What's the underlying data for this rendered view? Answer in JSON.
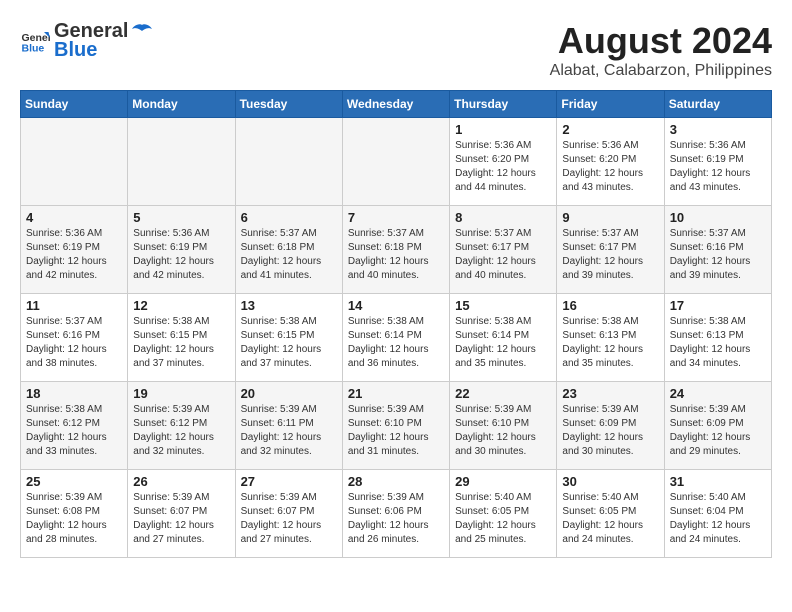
{
  "header": {
    "logo_general": "General",
    "logo_blue": "Blue",
    "month_year": "August 2024",
    "location": "Alabat, Calabarzon, Philippines"
  },
  "weekdays": [
    "Sunday",
    "Monday",
    "Tuesday",
    "Wednesday",
    "Thursday",
    "Friday",
    "Saturday"
  ],
  "weeks": [
    [
      {
        "day": "",
        "info": ""
      },
      {
        "day": "",
        "info": ""
      },
      {
        "day": "",
        "info": ""
      },
      {
        "day": "",
        "info": ""
      },
      {
        "day": "1",
        "info": "Sunrise: 5:36 AM\nSunset: 6:20 PM\nDaylight: 12 hours\nand 44 minutes."
      },
      {
        "day": "2",
        "info": "Sunrise: 5:36 AM\nSunset: 6:20 PM\nDaylight: 12 hours\nand 43 minutes."
      },
      {
        "day": "3",
        "info": "Sunrise: 5:36 AM\nSunset: 6:19 PM\nDaylight: 12 hours\nand 43 minutes."
      }
    ],
    [
      {
        "day": "4",
        "info": "Sunrise: 5:36 AM\nSunset: 6:19 PM\nDaylight: 12 hours\nand 42 minutes."
      },
      {
        "day": "5",
        "info": "Sunrise: 5:36 AM\nSunset: 6:19 PM\nDaylight: 12 hours\nand 42 minutes."
      },
      {
        "day": "6",
        "info": "Sunrise: 5:37 AM\nSunset: 6:18 PM\nDaylight: 12 hours\nand 41 minutes."
      },
      {
        "day": "7",
        "info": "Sunrise: 5:37 AM\nSunset: 6:18 PM\nDaylight: 12 hours\nand 40 minutes."
      },
      {
        "day": "8",
        "info": "Sunrise: 5:37 AM\nSunset: 6:17 PM\nDaylight: 12 hours\nand 40 minutes."
      },
      {
        "day": "9",
        "info": "Sunrise: 5:37 AM\nSunset: 6:17 PM\nDaylight: 12 hours\nand 39 minutes."
      },
      {
        "day": "10",
        "info": "Sunrise: 5:37 AM\nSunset: 6:16 PM\nDaylight: 12 hours\nand 39 minutes."
      }
    ],
    [
      {
        "day": "11",
        "info": "Sunrise: 5:37 AM\nSunset: 6:16 PM\nDaylight: 12 hours\nand 38 minutes."
      },
      {
        "day": "12",
        "info": "Sunrise: 5:38 AM\nSunset: 6:15 PM\nDaylight: 12 hours\nand 37 minutes."
      },
      {
        "day": "13",
        "info": "Sunrise: 5:38 AM\nSunset: 6:15 PM\nDaylight: 12 hours\nand 37 minutes."
      },
      {
        "day": "14",
        "info": "Sunrise: 5:38 AM\nSunset: 6:14 PM\nDaylight: 12 hours\nand 36 minutes."
      },
      {
        "day": "15",
        "info": "Sunrise: 5:38 AM\nSunset: 6:14 PM\nDaylight: 12 hours\nand 35 minutes."
      },
      {
        "day": "16",
        "info": "Sunrise: 5:38 AM\nSunset: 6:13 PM\nDaylight: 12 hours\nand 35 minutes."
      },
      {
        "day": "17",
        "info": "Sunrise: 5:38 AM\nSunset: 6:13 PM\nDaylight: 12 hours\nand 34 minutes."
      }
    ],
    [
      {
        "day": "18",
        "info": "Sunrise: 5:38 AM\nSunset: 6:12 PM\nDaylight: 12 hours\nand 33 minutes."
      },
      {
        "day": "19",
        "info": "Sunrise: 5:39 AM\nSunset: 6:12 PM\nDaylight: 12 hours\nand 32 minutes."
      },
      {
        "day": "20",
        "info": "Sunrise: 5:39 AM\nSunset: 6:11 PM\nDaylight: 12 hours\nand 32 minutes."
      },
      {
        "day": "21",
        "info": "Sunrise: 5:39 AM\nSunset: 6:10 PM\nDaylight: 12 hours\nand 31 minutes."
      },
      {
        "day": "22",
        "info": "Sunrise: 5:39 AM\nSunset: 6:10 PM\nDaylight: 12 hours\nand 30 minutes."
      },
      {
        "day": "23",
        "info": "Sunrise: 5:39 AM\nSunset: 6:09 PM\nDaylight: 12 hours\nand 30 minutes."
      },
      {
        "day": "24",
        "info": "Sunrise: 5:39 AM\nSunset: 6:09 PM\nDaylight: 12 hours\nand 29 minutes."
      }
    ],
    [
      {
        "day": "25",
        "info": "Sunrise: 5:39 AM\nSunset: 6:08 PM\nDaylight: 12 hours\nand 28 minutes."
      },
      {
        "day": "26",
        "info": "Sunrise: 5:39 AM\nSunset: 6:07 PM\nDaylight: 12 hours\nand 27 minutes."
      },
      {
        "day": "27",
        "info": "Sunrise: 5:39 AM\nSunset: 6:07 PM\nDaylight: 12 hours\nand 27 minutes."
      },
      {
        "day": "28",
        "info": "Sunrise: 5:39 AM\nSunset: 6:06 PM\nDaylight: 12 hours\nand 26 minutes."
      },
      {
        "day": "29",
        "info": "Sunrise: 5:40 AM\nSunset: 6:05 PM\nDaylight: 12 hours\nand 25 minutes."
      },
      {
        "day": "30",
        "info": "Sunrise: 5:40 AM\nSunset: 6:05 PM\nDaylight: 12 hours\nand 24 minutes."
      },
      {
        "day": "31",
        "info": "Sunrise: 5:40 AM\nSunset: 6:04 PM\nDaylight: 12 hours\nand 24 minutes."
      }
    ]
  ]
}
